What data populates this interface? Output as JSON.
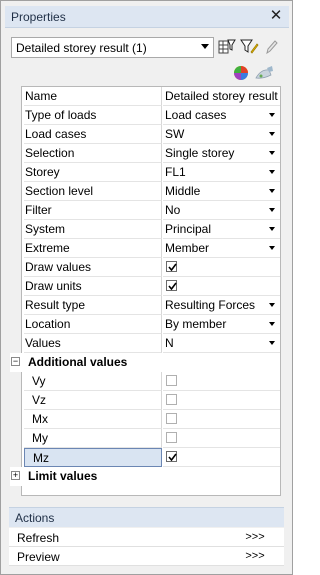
{
  "panel": {
    "title": "Properties",
    "close_glyph": "✕"
  },
  "selector": {
    "value": "Detailed storey result (1)",
    "tools": [
      "table-filter-icon",
      "funnel-edit-icon",
      "pencil-icon"
    ],
    "row2_icons": [
      "color-palette-icon",
      "paint-brush-icon"
    ]
  },
  "properties": [
    {
      "name": "Name",
      "value": "Detailed storey result",
      "type": "text"
    },
    {
      "name": "Type of loads",
      "value": "Load cases",
      "type": "select"
    },
    {
      "name": "Load cases",
      "value": "SW",
      "type": "select"
    },
    {
      "name": "Selection",
      "value": "Single storey",
      "type": "select"
    },
    {
      "name": "Storey",
      "value": "FL1",
      "type": "select"
    },
    {
      "name": "Section level",
      "value": "Middle",
      "type": "select"
    },
    {
      "name": "Filter",
      "value": "No",
      "type": "select"
    },
    {
      "name": "System",
      "value": "Principal",
      "type": "select"
    },
    {
      "name": "Extreme",
      "value": "Member",
      "type": "select"
    },
    {
      "name": "Draw values",
      "checked": true,
      "type": "check"
    },
    {
      "name": "Draw units",
      "checked": true,
      "type": "check"
    },
    {
      "name": "Result type",
      "value": "Resulting Forces",
      "type": "select"
    },
    {
      "name": "Location",
      "value": "By member",
      "type": "select"
    },
    {
      "name": "Values",
      "value": "N",
      "type": "select"
    }
  ],
  "additional": {
    "label": "Additional values",
    "toggle": "−",
    "items": [
      {
        "name": "Vy",
        "checked": false
      },
      {
        "name": "Vz",
        "checked": false
      },
      {
        "name": "Mx",
        "checked": false
      },
      {
        "name": "My",
        "checked": false
      },
      {
        "name": "Mz",
        "checked": true,
        "selected": true
      }
    ]
  },
  "limit": {
    "label": "Limit values",
    "toggle": "+"
  },
  "actions": {
    "label": "Actions",
    "items": [
      {
        "label": "Refresh",
        "button": ">>>"
      },
      {
        "label": "Preview",
        "button": ">>>"
      }
    ]
  }
}
